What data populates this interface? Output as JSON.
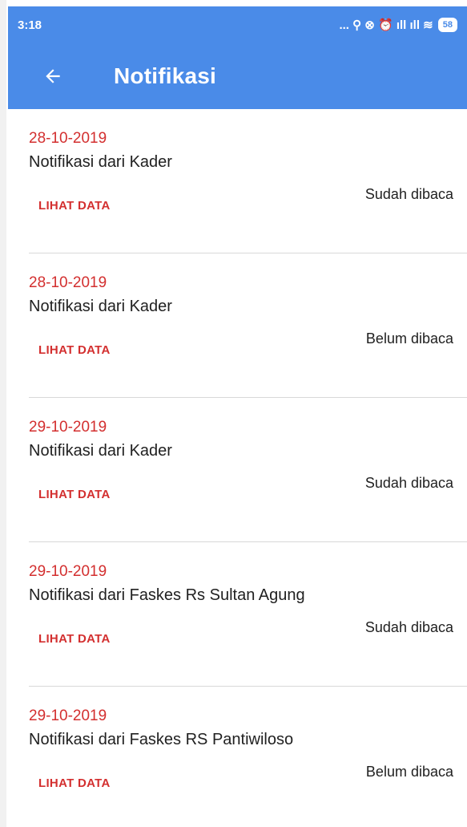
{
  "statusbar": {
    "time": "3:18",
    "icons": "... ⚲ ⊗ ⏰ ıll ıll ≋",
    "battery": "58"
  },
  "toolbar": {
    "back_icon": "arrow-left-icon",
    "title": "Notifikasi"
  },
  "colors": {
    "app_bar": "#4a8be8",
    "accent_red": "#d32f2f",
    "text": "#212121"
  },
  "notifications": [
    {
      "date": "28-10-2019",
      "title": "Notifikasi dari Kader",
      "link": "LIHAT DATA",
      "status": "Sudah dibaca"
    },
    {
      "date": "28-10-2019",
      "title": "Notifikasi dari Kader",
      "link": "LIHAT DATA",
      "status": "Belum dibaca"
    },
    {
      "date": "29-10-2019",
      "title": "Notifikasi dari Kader",
      "link": "LIHAT DATA",
      "status": "Sudah dibaca"
    },
    {
      "date": "29-10-2019",
      "title": "Notifikasi dari Faskes Rs Sultan Agung",
      "link": "LIHAT DATA",
      "status": "Sudah dibaca"
    },
    {
      "date": "29-10-2019",
      "title": "Notifikasi dari Faskes RS Pantiwiloso",
      "link": "LIHAT DATA",
      "status": "Belum dibaca"
    }
  ]
}
